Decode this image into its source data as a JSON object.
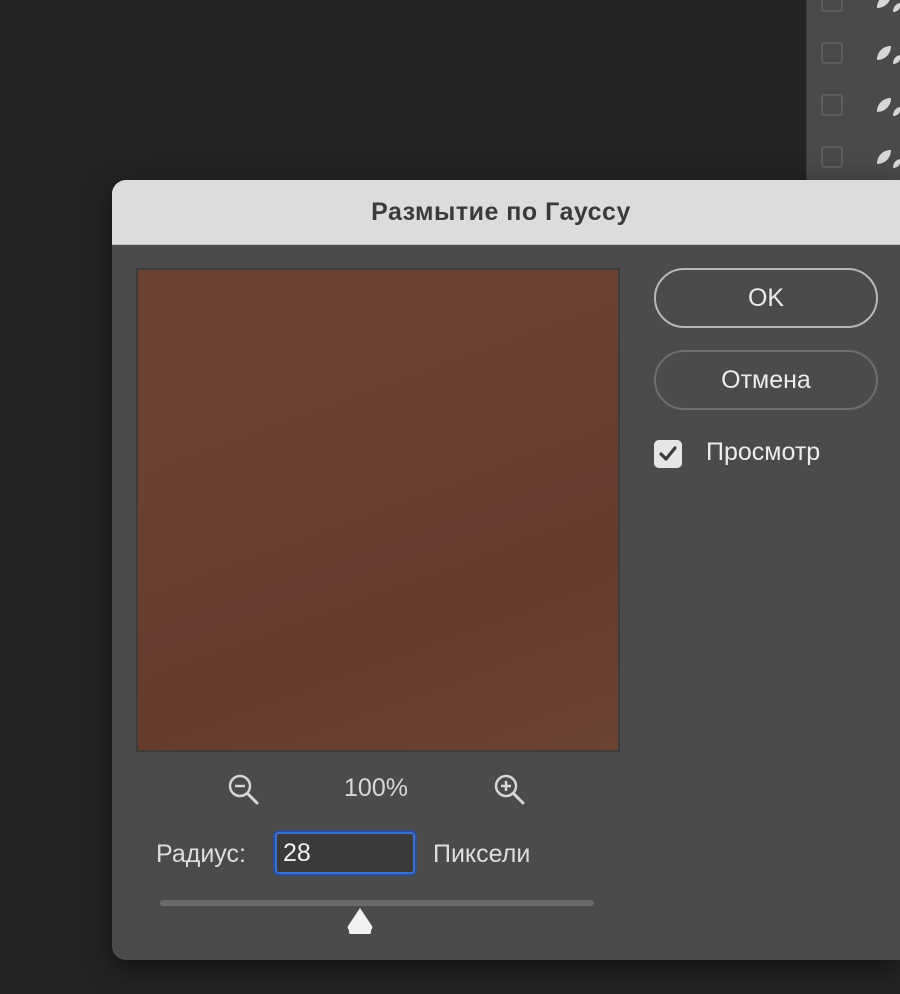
{
  "dialog": {
    "title": "Размытие по Гауссу",
    "preview_color": "#6a3f31",
    "zoom": {
      "level": "100%",
      "zoom_out_icon": "zoom-out-icon",
      "zoom_in_icon": "zoom-in-icon"
    },
    "radius": {
      "label": "Радиус:",
      "value": "28",
      "unit": "Пиксели",
      "slider_position": 0.46
    },
    "buttons": {
      "ok_label": "OK",
      "cancel_label": "Отмена"
    },
    "preview_checkbox": {
      "label": "Просмотр",
      "checked": true
    }
  },
  "colors": {
    "background": "#242424",
    "dialog_body": "#4b4b4b",
    "title_bar": "#dcdcdc",
    "focus_ring": "#3d6fd1"
  }
}
